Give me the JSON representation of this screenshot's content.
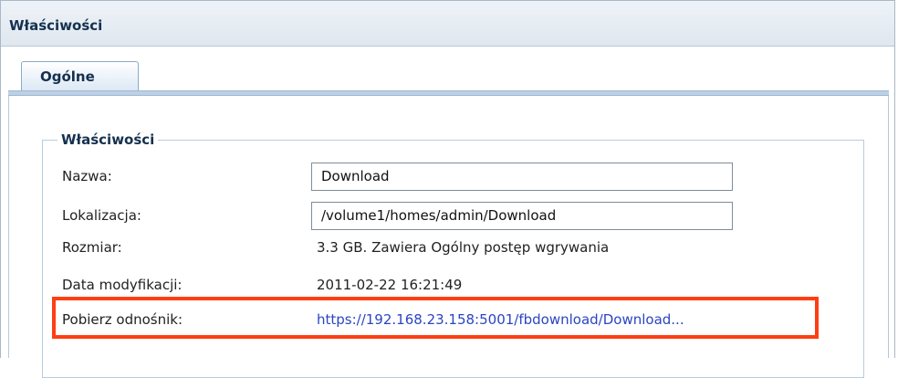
{
  "window": {
    "title": "Właściwości"
  },
  "tabs": [
    {
      "label": "Ogólne"
    }
  ],
  "properties": {
    "legend": "Właściwości",
    "fields": {
      "name_label": "Nazwa:",
      "name_value": "Download",
      "location_label": "Lokalizacja:",
      "location_value": "/volume1/homes/admin/Download",
      "size_label": "Rozmiar:",
      "size_value": "3.3 GB. Zawiera Ogólny postęp wgrywania",
      "modified_label": "Data modyfikacji:",
      "modified_value": "2011-02-22 16:21:49",
      "download_label": "Pobierz odnośnik:",
      "download_value": "https://192.168.23.158:5001/fbdownload/Download..."
    }
  },
  "colors": {
    "highlight": "#ff3e12",
    "link": "#2a45c4",
    "title_text": "#15314f"
  }
}
